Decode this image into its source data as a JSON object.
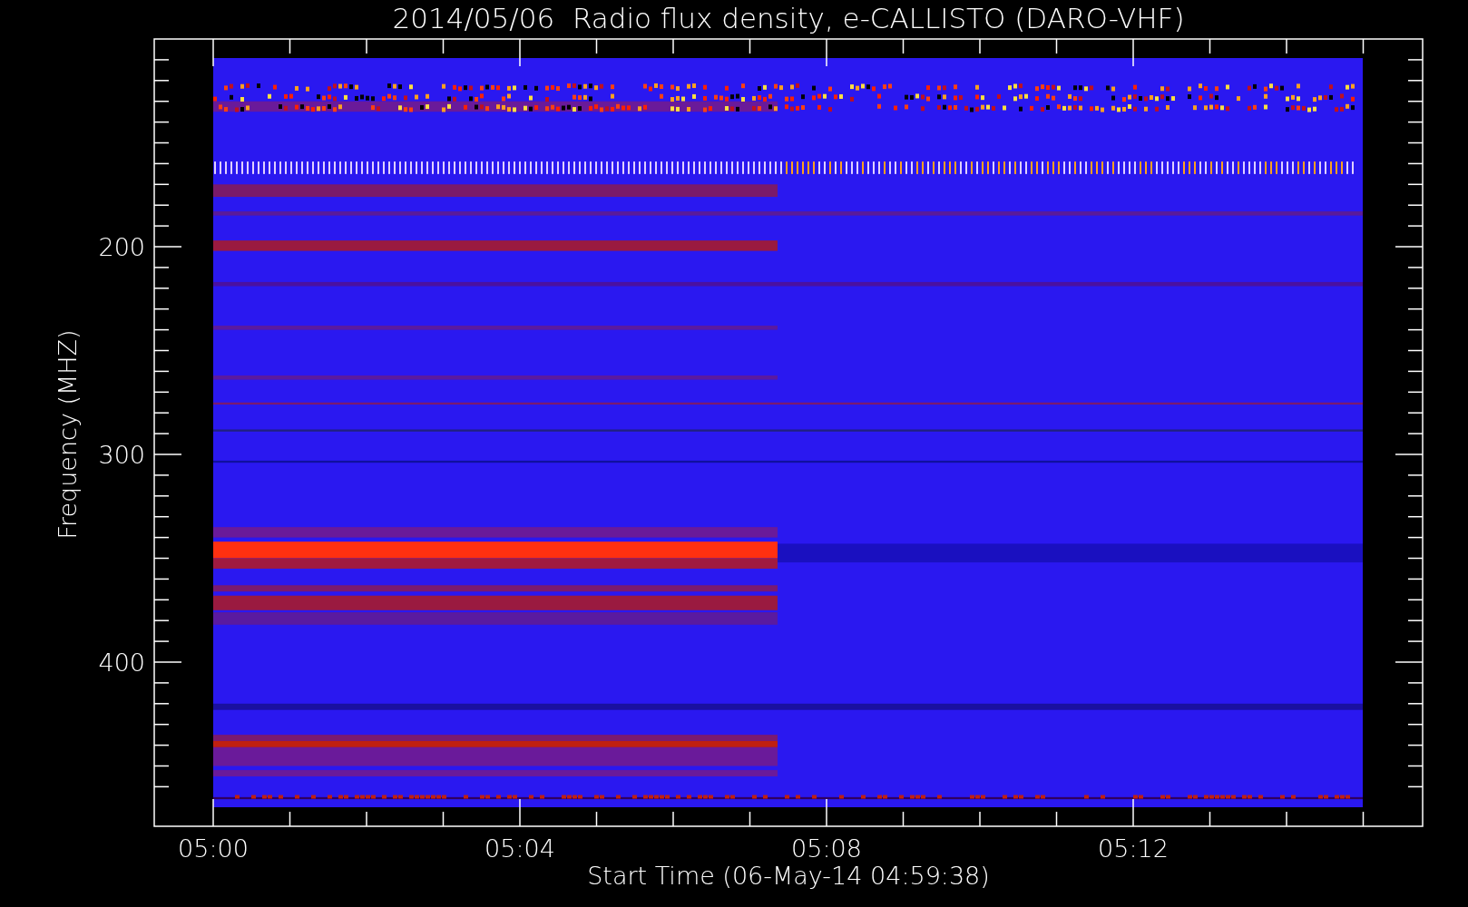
{
  "title": "2014/05/06  Radio flux density, e-CALLISTO (DARO-VHF)",
  "y_axis": {
    "label": "Frequency (MHZ)",
    "ticks": [
      "200",
      "300",
      "400"
    ]
  },
  "x_axis": {
    "label": "Start Time (06-May-14 04:59:38)",
    "ticks": [
      "05:00",
      "05:04",
      "05:08",
      "05:12"
    ]
  }
}
